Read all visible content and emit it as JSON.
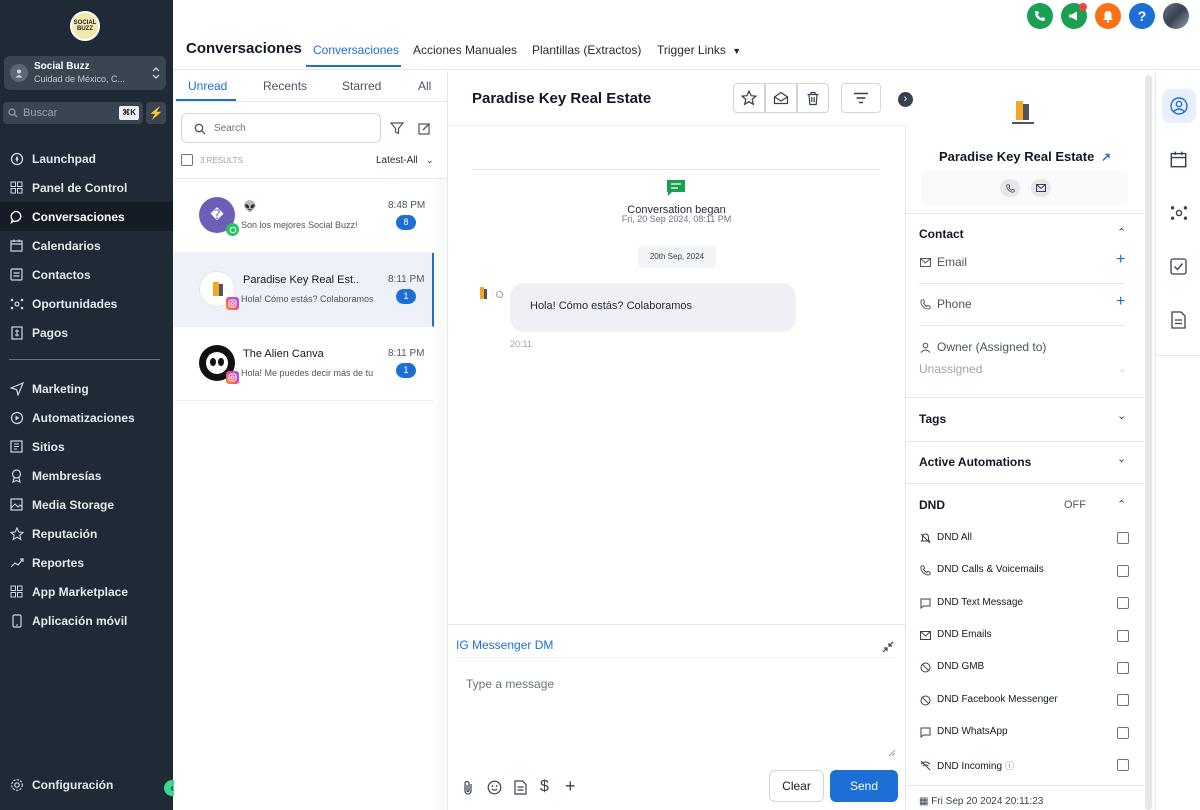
{
  "sidebar": {
    "logo_text": "SOCIAL BUZZ",
    "account_name": "Social Buzz",
    "account_location": "Cuidad de México, C...",
    "search_placeholder": "Buscar",
    "search_shortcut": "⌘K",
    "items": [
      {
        "label": "Launchpad",
        "icon": "rocket-icon"
      },
      {
        "label": "Panel de Control",
        "icon": "dashboard-icon"
      },
      {
        "label": "Conversaciones",
        "icon": "chat-icon"
      },
      {
        "label": "Calendarios",
        "icon": "calendar-icon"
      },
      {
        "label": "Contactos",
        "icon": "contacts-icon"
      },
      {
        "label": "Oportunidades",
        "icon": "opportunities-icon"
      },
      {
        "label": "Pagos",
        "icon": "payments-icon"
      },
      {
        "label": "Marketing",
        "icon": "send-icon"
      },
      {
        "label": "Automatizaciones",
        "icon": "automation-icon"
      },
      {
        "label": "Sitios",
        "icon": "sites-icon"
      },
      {
        "label": "Membresías",
        "icon": "membership-icon"
      },
      {
        "label": "Media Storage",
        "icon": "image-icon"
      },
      {
        "label": "Reputación",
        "icon": "star-icon"
      },
      {
        "label": "Reportes",
        "icon": "trend-icon"
      },
      {
        "label": "App Marketplace",
        "icon": "grid-icon"
      },
      {
        "label": "Aplicación móvil",
        "icon": "mobile-icon"
      }
    ],
    "settings_label": "Configuración"
  },
  "header": {
    "title": "Conversaciones",
    "tabs": [
      "Conversaciones",
      "Acciones Manuales",
      "Plantillas (Extractos)",
      "Trigger Links"
    ]
  },
  "list": {
    "tabs": [
      "Unread",
      "Recents",
      "Starred",
      "All"
    ],
    "search_placeholder": "Search",
    "results": "3 RESULTS",
    "sort": "Latest-All",
    "conversations": [
      {
        "name": "👽",
        "avatar_glyph": "�",
        "preview": "Son los mejores Social Buzz!",
        "time": "8:48 PM",
        "unread": "8",
        "channel": "whatsapp"
      },
      {
        "name": "Paradise Key Real Est..",
        "preview": "Hola! Cómo estás? Colaboramos",
        "time": "8:11 PM",
        "unread": "1",
        "channel": "instagram"
      },
      {
        "name": "The Alien Canva",
        "preview": "Hola! Me puedes decir más de tu",
        "time": "8:11 PM",
        "unread": "1",
        "channel": "instagram"
      }
    ]
  },
  "chat": {
    "title": "Paradise Key Real Estate",
    "began_label": "Conversation began",
    "began_date": "Fri, 20 Sep 2024, 08:11 PM",
    "date_pill": "20th Sep, 2024",
    "message": "Hola! Cómo estás? Colaboramos",
    "message_time": "20:11",
    "channel_label": "IG Messenger DM",
    "placeholder": "Type a message",
    "clear_label": "Clear",
    "send_label": "Send"
  },
  "detail": {
    "name": "Paradise Key Real Estate",
    "contact_header": "Contact",
    "email_label": "Email",
    "phone_label": "Phone",
    "owner_label": "Owner (Assigned to)",
    "owner_value": "Unassigned",
    "tags_header": "Tags",
    "automations_header": "Active Automations",
    "dnd_header": "DND",
    "dnd_state": "OFF",
    "dnd_items": [
      "DND All",
      "DND Calls & Voicemails",
      "DND Text Message",
      "DND Emails",
      "DND GMB",
      "DND Facebook Messenger",
      "DND WhatsApp",
      "DND Incoming"
    ],
    "footer_date": "Fri Sep 20 2024 20:11:23"
  },
  "colors": {
    "accent": "#1d6fd6",
    "sidebar_bg": "#202a36",
    "green": "#1aa053"
  }
}
